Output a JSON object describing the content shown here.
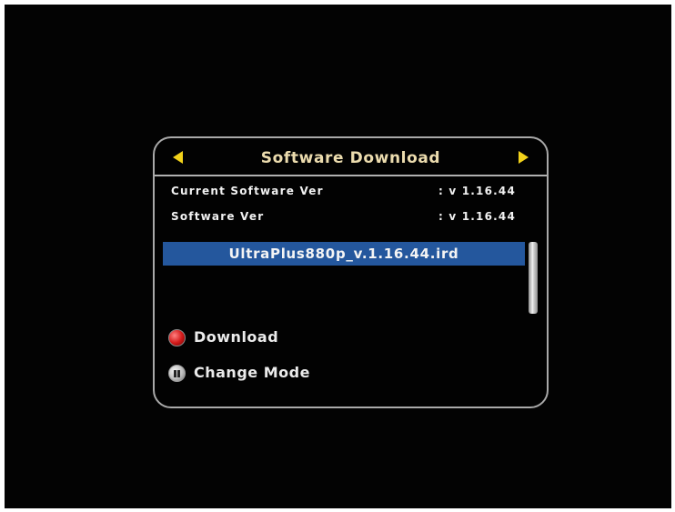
{
  "dialog": {
    "title": "Software Download",
    "left_arrow_icon": "left-arrow-icon",
    "right_arrow_icon": "right-arrow-icon"
  },
  "info": {
    "current_label": "Current Software Ver",
    "current_value": ": v 1.16.44",
    "software_label": "Software Ver",
    "software_value": ": v 1.16.44"
  },
  "file_list": {
    "items": [
      {
        "label": "UltraPlus880p_v.1.16.44.ird",
        "selected": true
      }
    ]
  },
  "actions": {
    "download": {
      "label": "Download",
      "icon": "red-button-icon",
      "color": "#d31a1a"
    },
    "change_mode": {
      "label": "Change Mode",
      "icon": "pause-button-icon",
      "color": "#bdbdbd"
    }
  },
  "colors": {
    "accent": "#f2d21a",
    "selection": "#24579d",
    "background": "#030303",
    "title": "#ecdcae"
  }
}
